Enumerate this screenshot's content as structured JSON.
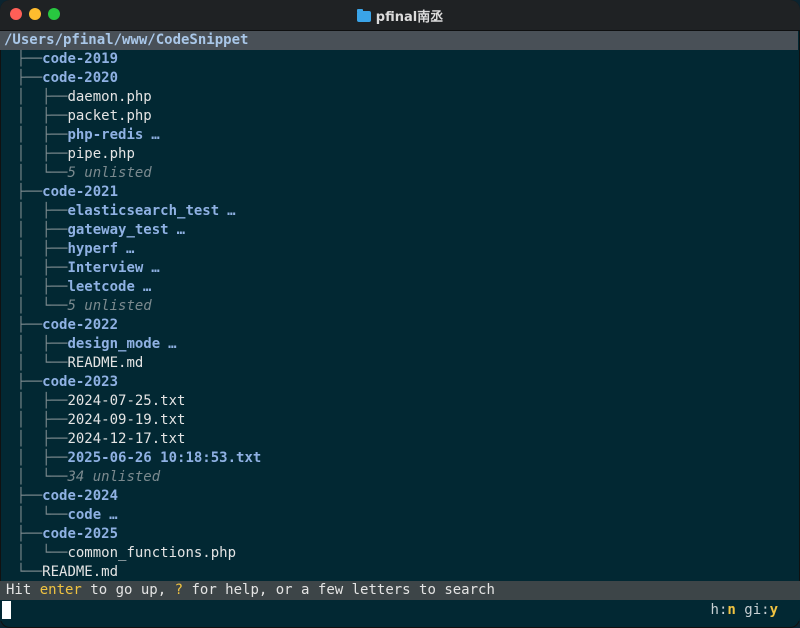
{
  "window": {
    "title": "pfinal南丞",
    "title_icon": "folder-icon"
  },
  "path": "/Users/pfinal/www/CodeSnippet",
  "tree": [
    {
      "guide": "  ├──",
      "text": "code-2019",
      "kind": "dir"
    },
    {
      "guide": "  ├──",
      "text": "code-2020",
      "kind": "dir"
    },
    {
      "guide": "  │  ├──",
      "text": "daemon.php",
      "kind": "file"
    },
    {
      "guide": "  │  ├──",
      "text": "packet.php",
      "kind": "file"
    },
    {
      "guide": "  │  ├──",
      "text": "php-redis",
      "kind": "dir",
      "more": "…"
    },
    {
      "guide": "  │  ├──",
      "text": "pipe.php",
      "kind": "file"
    },
    {
      "guide": "  │  └──",
      "text": "5 unlisted",
      "kind": "unlisted"
    },
    {
      "guide": "  ├──",
      "text": "code-2021",
      "kind": "dir"
    },
    {
      "guide": "  │  ├──",
      "text": "elasticsearch_test",
      "kind": "dir",
      "more": "…"
    },
    {
      "guide": "  │  ├──",
      "text": "gateway_test",
      "kind": "dir",
      "more": "…"
    },
    {
      "guide": "  │  ├──",
      "text": "hyperf",
      "kind": "dir",
      "more": "…"
    },
    {
      "guide": "  │  ├──",
      "text": "Interview",
      "kind": "dir",
      "more": "…"
    },
    {
      "guide": "  │  ├──",
      "text": "leetcode",
      "kind": "dir",
      "more": "…"
    },
    {
      "guide": "  │  └──",
      "text": "5 unlisted",
      "kind": "unlisted"
    },
    {
      "guide": "  ├──",
      "text": "code-2022",
      "kind": "dir"
    },
    {
      "guide": "  │  ├──",
      "text": "design_mode",
      "kind": "dir",
      "more": "…"
    },
    {
      "guide": "  │  └──",
      "text": "README.md",
      "kind": "file"
    },
    {
      "guide": "  ├──",
      "text": "code-2023",
      "kind": "dir"
    },
    {
      "guide": "  │  ├──",
      "text": "2024-07-25.txt",
      "kind": "file"
    },
    {
      "guide": "  │  ├──",
      "text": "2024-09-19.txt",
      "kind": "file"
    },
    {
      "guide": "  │  ├──",
      "text": "2024-12-17.txt",
      "kind": "file"
    },
    {
      "guide": "  │  ├──",
      "text": "2025-06-26 10:18:53.txt",
      "kind": "sel"
    },
    {
      "guide": "  │  └──",
      "text": "34 unlisted",
      "kind": "unlisted"
    },
    {
      "guide": "  ├──",
      "text": "code-2024",
      "kind": "dir"
    },
    {
      "guide": "  │  └──",
      "text": "code",
      "kind": "dir",
      "more": "…"
    },
    {
      "guide": "  ├──",
      "text": "code-2025",
      "kind": "dir"
    },
    {
      "guide": "  │  └──",
      "text": "common_functions.php",
      "kind": "file"
    },
    {
      "guide": "  └──",
      "text": "README.md",
      "kind": "file"
    }
  ],
  "status": {
    "hit": "Hit ",
    "enter": "enter",
    "to_go_up": " to go up, ",
    "question": "?",
    "rest": " for help, or a few letters to search"
  },
  "flags": {
    "h_label": "h:",
    "h_value": "n",
    "gi_label": "gi:",
    "gi_value": "y"
  }
}
